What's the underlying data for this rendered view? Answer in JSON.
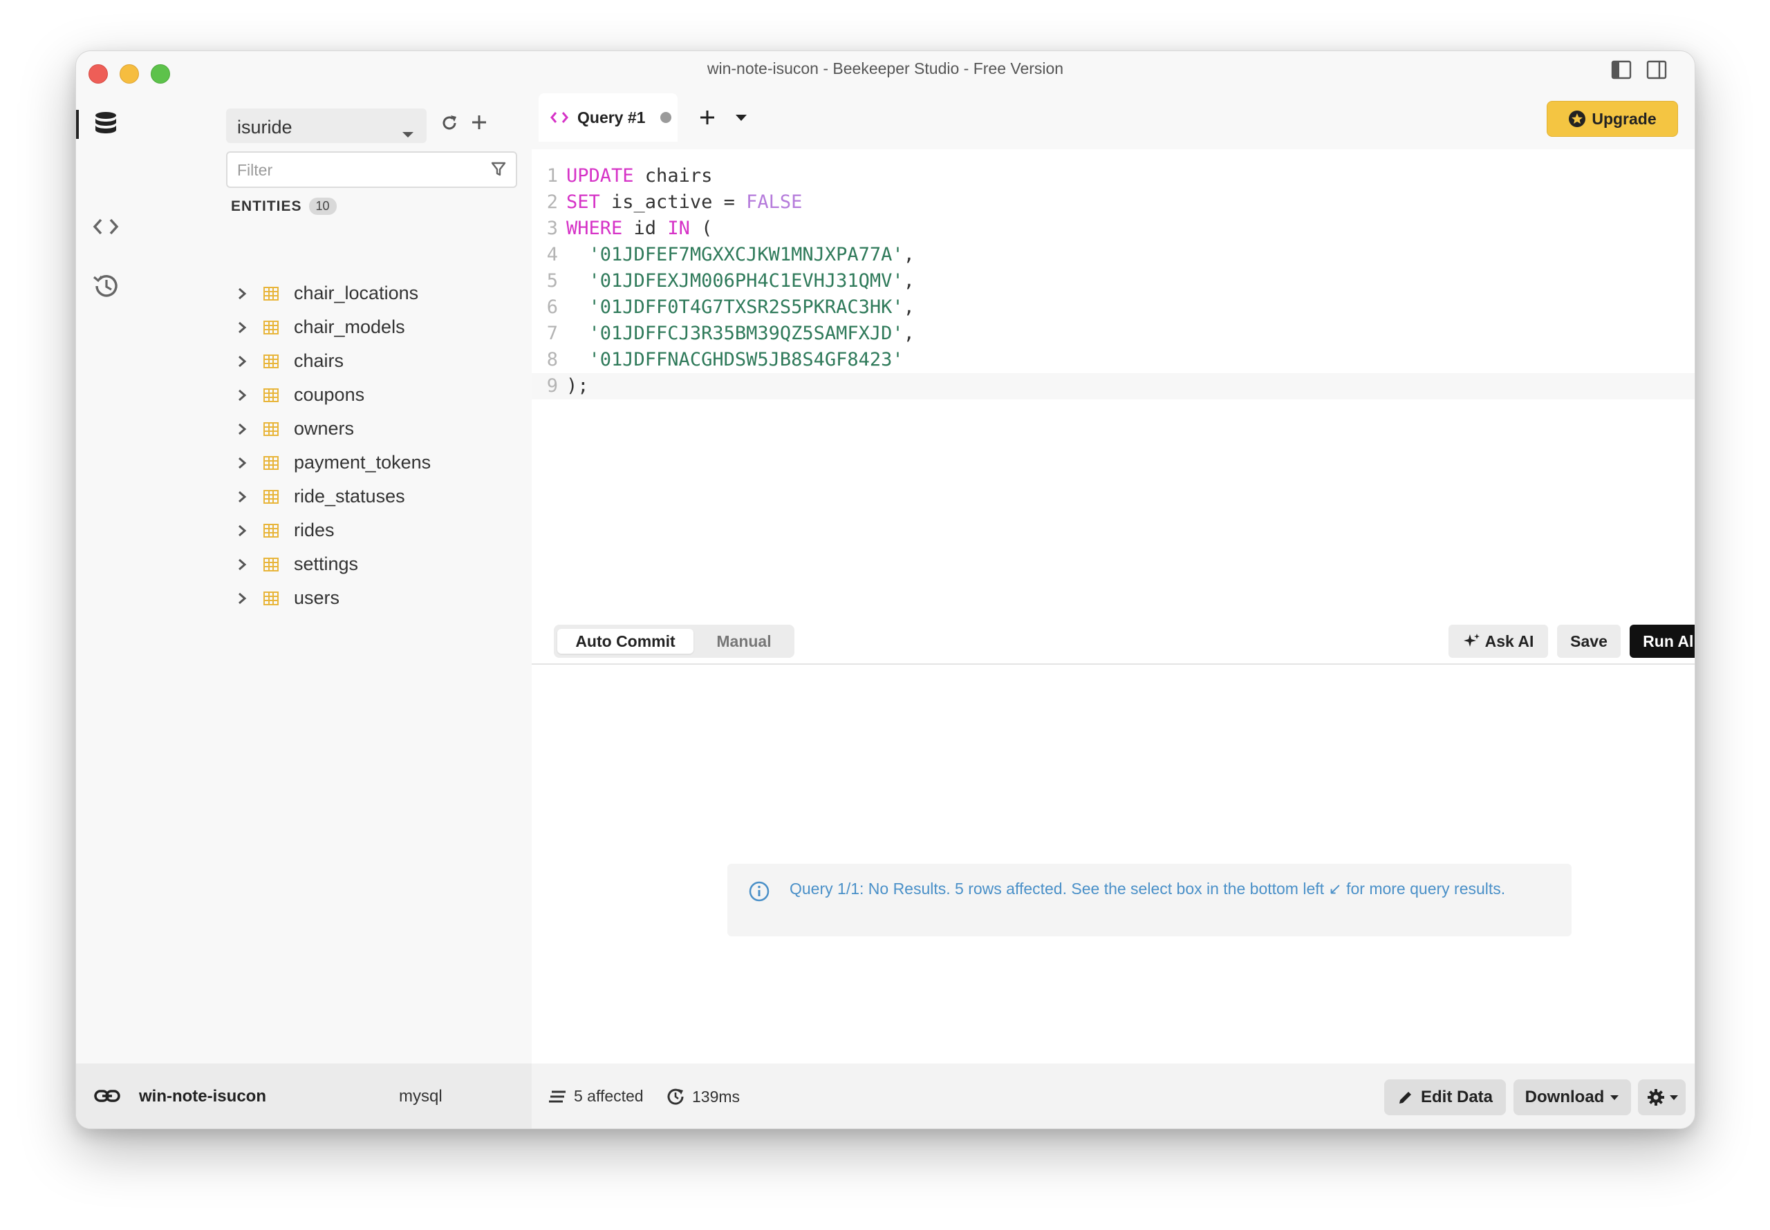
{
  "window": {
    "title": "win-note-isucon - Beekeeper Studio - Free Version"
  },
  "sidebar": {
    "connection": "isuride",
    "filter_placeholder": "Filter",
    "entities_label": "ENTITIES",
    "entities_count": "10",
    "entities": [
      {
        "name": "chair_locations"
      },
      {
        "name": "chair_models"
      },
      {
        "name": "chairs"
      },
      {
        "name": "coupons"
      },
      {
        "name": "owners"
      },
      {
        "name": "payment_tokens"
      },
      {
        "name": "ride_statuses"
      },
      {
        "name": "rides"
      },
      {
        "name": "settings"
      },
      {
        "name": "users"
      }
    ]
  },
  "tabs": {
    "active_label": "Query #1",
    "upgrade_label": "Upgrade"
  },
  "editor": {
    "line_numbers": [
      "1",
      "2",
      "3",
      "4",
      "5",
      "6",
      "7",
      "8",
      "9"
    ],
    "l1": {
      "kw": "UPDATE",
      "rest": " chairs"
    },
    "l2": {
      "kw": "SET",
      "mid": " is_active = ",
      "val": "FALSE"
    },
    "l3": {
      "kw1": "WHERE",
      "mid": " id ",
      "kw2": "IN",
      "rest": " ("
    },
    "strings": [
      "'01JDFEF7MGXXCJKW1MNJXPA77A'",
      "'01JDFEXJM006PH4C1EVHJ31QMV'",
      "'01JDFF0T4G7TXSR2S5PKRAC3HK'",
      "'01JDFFCJ3R35BM39QZ5SAMFXJD'",
      "'01JDFFNACGHDSW5JB8S4GF8423'"
    ],
    "comma": ",",
    "l9": ");"
  },
  "query_toolbar": {
    "auto_commit": "Auto Commit",
    "manual": "Manual",
    "ask_ai": "Ask AI",
    "save": "Save",
    "run_all": "Run All"
  },
  "results": {
    "message": "Query 1/1: No Results. 5 rows affected. See the select box in the bottom left ↙ for more query results."
  },
  "statusbar": {
    "connection_name": "win-note-isucon",
    "db_type": "mysql",
    "affected": "5 affected",
    "duration": "139ms",
    "edit_data": "Edit Data",
    "download": "Download"
  },
  "colors": {
    "keyword": "#d633c7",
    "boolean": "#b57bdb",
    "string": "#2f7a5a",
    "accent_upgrade": "#f4c542",
    "info_text": "#4a90c8",
    "table_icon": "#e8b53a"
  }
}
